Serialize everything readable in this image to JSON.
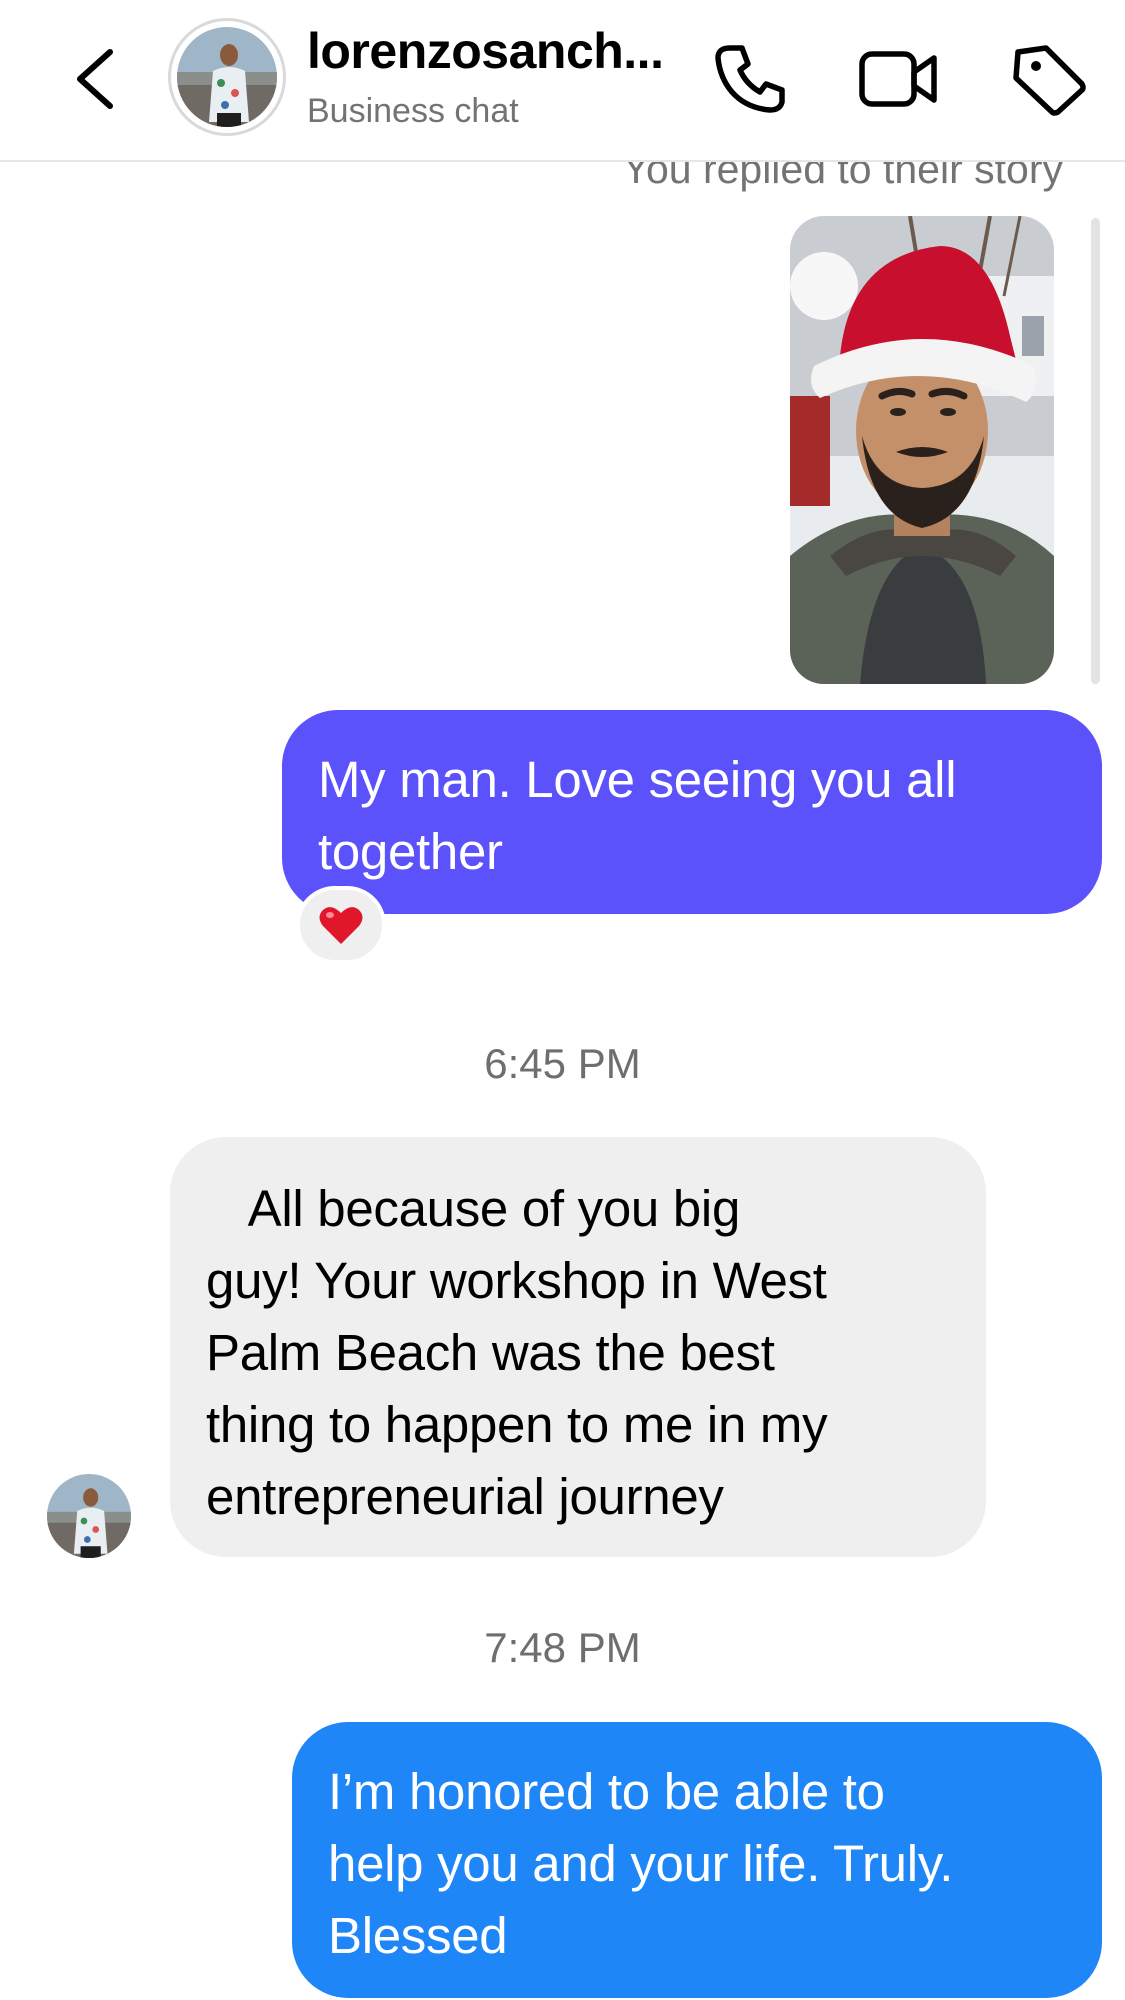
{
  "header": {
    "username": "lorenzosanch...",
    "subtitle": "Business chat",
    "icons": [
      "chevron-left-icon",
      "phone-icon",
      "video-camera-icon",
      "tag-icon"
    ]
  },
  "conversation": {
    "story_reply_label": "You replied to their story",
    "messages": [
      {
        "direction": "outgoing",
        "text": "My man. Love seeing you all\ntogether",
        "reaction": "❤️",
        "color": "#5b52fb"
      },
      {
        "timestamp": "6:45 PM"
      },
      {
        "direction": "incoming",
        "text": "   All because of you big\nguy! Your workshop in West\nPalm Beach was the best\nthing to happen to me in my\nentrepreneurial journey",
        "color": "#efefef"
      },
      {
        "timestamp": "7:48 PM"
      },
      {
        "direction": "outgoing",
        "text": "I’m honored to be able to\nhelp you and your life. Truly.\nBlessed",
        "color": "#1e86f7"
      }
    ]
  }
}
